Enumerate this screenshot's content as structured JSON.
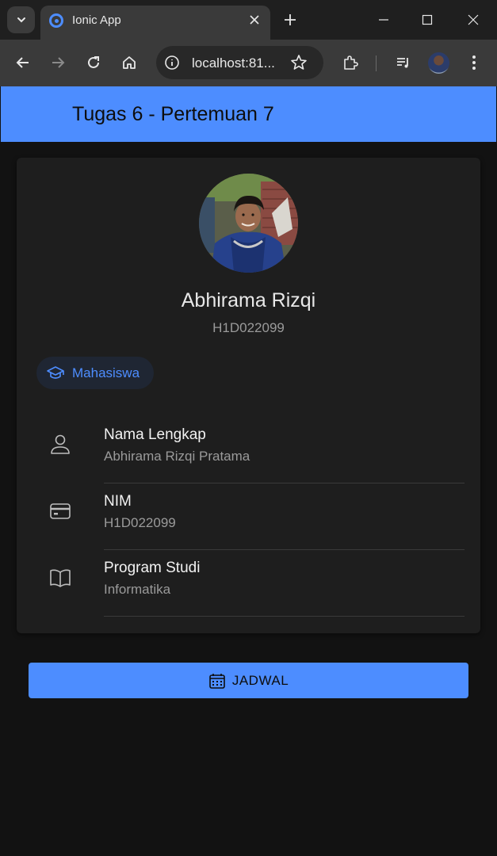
{
  "browser": {
    "tab_title": "Ionic App",
    "url": "localhost:81...",
    "icons": {
      "tab_search": "chevron-down-icon",
      "tab_favicon": "ionic-icon",
      "tab_close": "close-icon",
      "new_tab": "plus-icon",
      "minimize": "minimize-icon",
      "maximize": "maximize-icon",
      "close_window": "close-icon",
      "back": "arrow-left-icon",
      "forward": "arrow-right-icon",
      "reload": "reload-icon",
      "home": "home-icon",
      "site_info": "info-icon",
      "bookmark": "star-icon",
      "extensions": "puzzle-icon",
      "media": "playlist-icon",
      "menu": "kebab-menu-icon"
    }
  },
  "app": {
    "header_title": "Tugas 6 - Pertemuan 7",
    "accent_color": "#4d8dff"
  },
  "profile": {
    "name": "Abhirama Rizqi",
    "nim": "H1D022099",
    "chip_label": "Mahasiswa",
    "chip_icon": "school-icon"
  },
  "details": [
    {
      "icon": "person-icon",
      "title": "Nama Lengkap",
      "value": "Abhirama Rizqi Pratama"
    },
    {
      "icon": "card-icon",
      "title": "NIM",
      "value": "H1D022099"
    },
    {
      "icon": "book-icon",
      "title": "Program Studi",
      "value": "Informatika"
    }
  ],
  "actions": {
    "jadwal_label": "JADWAL",
    "jadwal_icon": "calendar-icon"
  }
}
